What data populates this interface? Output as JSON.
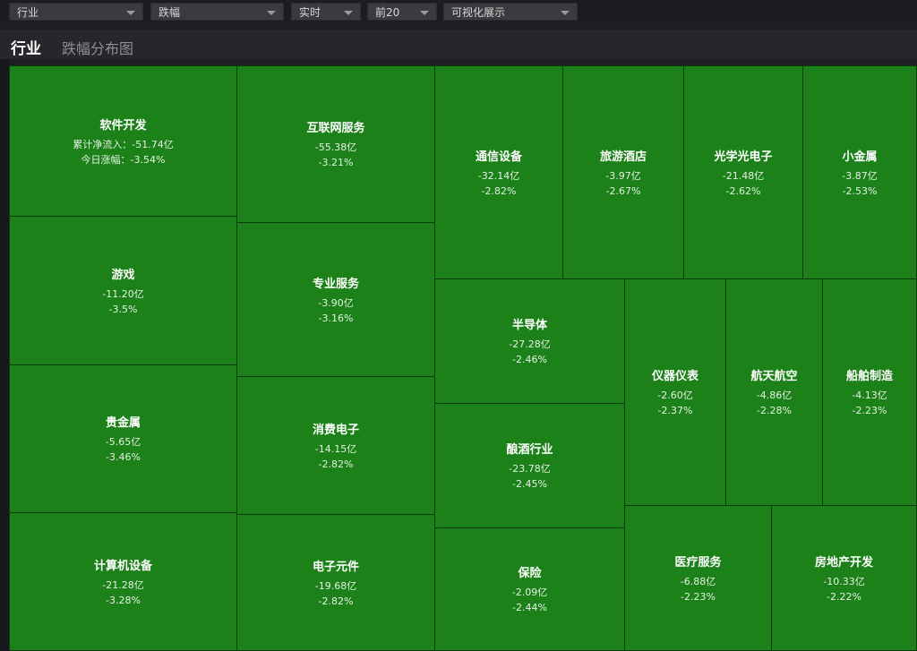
{
  "filters": {
    "category": "行业",
    "metric": "跌幅",
    "time": "实时",
    "top": "前20",
    "view": "可视化展示"
  },
  "tabs": {
    "active": "行业",
    "other": "跌幅分布图"
  },
  "labels": {
    "net_inflow_prefix": "累计净流入：",
    "change_prefix": "今日涨幅："
  },
  "cells": {
    "c1": {
      "name": "软件开发",
      "flow": "-51.74亿",
      "pct": "-3.54%"
    },
    "c2": {
      "name": "游戏",
      "flow": "-11.20亿",
      "pct": "-3.5%"
    },
    "c3": {
      "name": "贵金属",
      "flow": "-5.65亿",
      "pct": "-3.46%"
    },
    "c4": {
      "name": "计算机设备",
      "flow": "-21.28亿",
      "pct": "-3.28%"
    },
    "c5": {
      "name": "互联网服务",
      "flow": "-55.38亿",
      "pct": "-3.21%"
    },
    "c6": {
      "name": "专业服务",
      "flow": "-3.90亿",
      "pct": "-3.16%"
    },
    "c7": {
      "name": "消费电子",
      "flow": "-14.15亿",
      "pct": "-2.82%"
    },
    "c8": {
      "name": "电子元件",
      "flow": "-19.68亿",
      "pct": "-2.82%"
    },
    "c9": {
      "name": "通信设备",
      "flow": "-32.14亿",
      "pct": "-2.82%"
    },
    "c10": {
      "name": "旅游酒店",
      "flow": "-3.97亿",
      "pct": "-2.67%"
    },
    "c11": {
      "name": "光学光电子",
      "flow": "-21.48亿",
      "pct": "-2.62%"
    },
    "c12": {
      "name": "小金属",
      "flow": "-3.87亿",
      "pct": "-2.53%"
    },
    "c13": {
      "name": "半导体",
      "flow": "-27.28亿",
      "pct": "-2.46%"
    },
    "c14": {
      "name": "酿酒行业",
      "flow": "-23.78亿",
      "pct": "-2.45%"
    },
    "c15": {
      "name": "保险",
      "flow": "-2.09亿",
      "pct": "-2.44%"
    },
    "c16": {
      "name": "仪器仪表",
      "flow": "-2.60亿",
      "pct": "-2.37%"
    },
    "c17": {
      "name": "航天航空",
      "flow": "-4.86亿",
      "pct": "-2.28%"
    },
    "c18": {
      "name": "船舶制造",
      "flow": "-4.13亿",
      "pct": "-2.23%"
    },
    "c19": {
      "name": "医疗服务",
      "flow": "-6.88亿",
      "pct": "-2.23%"
    },
    "c20": {
      "name": "房地产开发",
      "flow": "-10.33亿",
      "pct": "-2.22%"
    }
  },
  "colors": {
    "cell_fill": "#1b8118",
    "cell_border": "#0b3a0c",
    "background": "#1e1f22"
  }
}
